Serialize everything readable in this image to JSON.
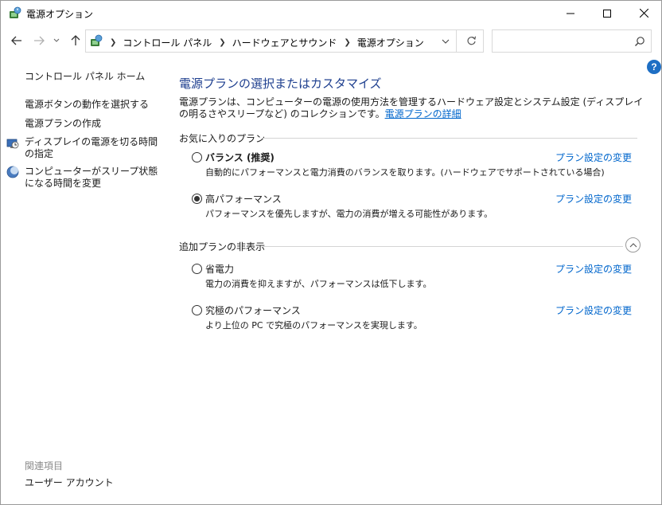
{
  "window": {
    "title": "電源オプション"
  },
  "address": {
    "crumbs": [
      "コントロール パネル",
      "ハードウェアとサウンド",
      "電源オプション"
    ],
    "search_placeholder": ""
  },
  "sidebar": {
    "home": "コントロール パネル ホーム",
    "items": [
      "電源ボタンの動作を選択する",
      "電源プランの作成",
      "ディスプレイの電源を切る時間の指定",
      "コンピューターがスリープ状態になる時間を変更"
    ],
    "related_heading": "関連項目",
    "related_items": [
      "ユーザー アカウント"
    ]
  },
  "main": {
    "title": "電源プランの選択またはカスタマイズ",
    "description": "電源プランは、コンピューターの電源の使用方法を管理するハードウェア設定とシステム設定 (ディスプレイの明るさやスリープなど) のコレクションです。",
    "description_link": "電源プランの詳細",
    "favorites_heading": "お気に入りのプラン",
    "hidden_heading": "追加プランの非表示",
    "change_link": "プラン設定の変更",
    "plans": [
      {
        "name": "バランス (推奨)",
        "desc": "自動的にパフォーマンスと電力消費のバランスを取ります。(ハードウェアでサポートされている場合)",
        "selected": false
      },
      {
        "name": "高パフォーマンス",
        "desc": "パフォーマンスを優先しますが、電力の消費が増える可能性があります。",
        "selected": true
      },
      {
        "name": "省電力",
        "desc": "電力の消費を抑えますが、パフォーマンスは低下します。",
        "selected": false
      },
      {
        "name": "究極のパフォーマンス",
        "desc": "より上位の PC で究極のパフォーマンスを実現します。",
        "selected": false
      }
    ]
  },
  "colors": {
    "title_blue": "#1e3f8f",
    "link_blue": "#0066cc",
    "help_blue": "#1e6fc4"
  }
}
